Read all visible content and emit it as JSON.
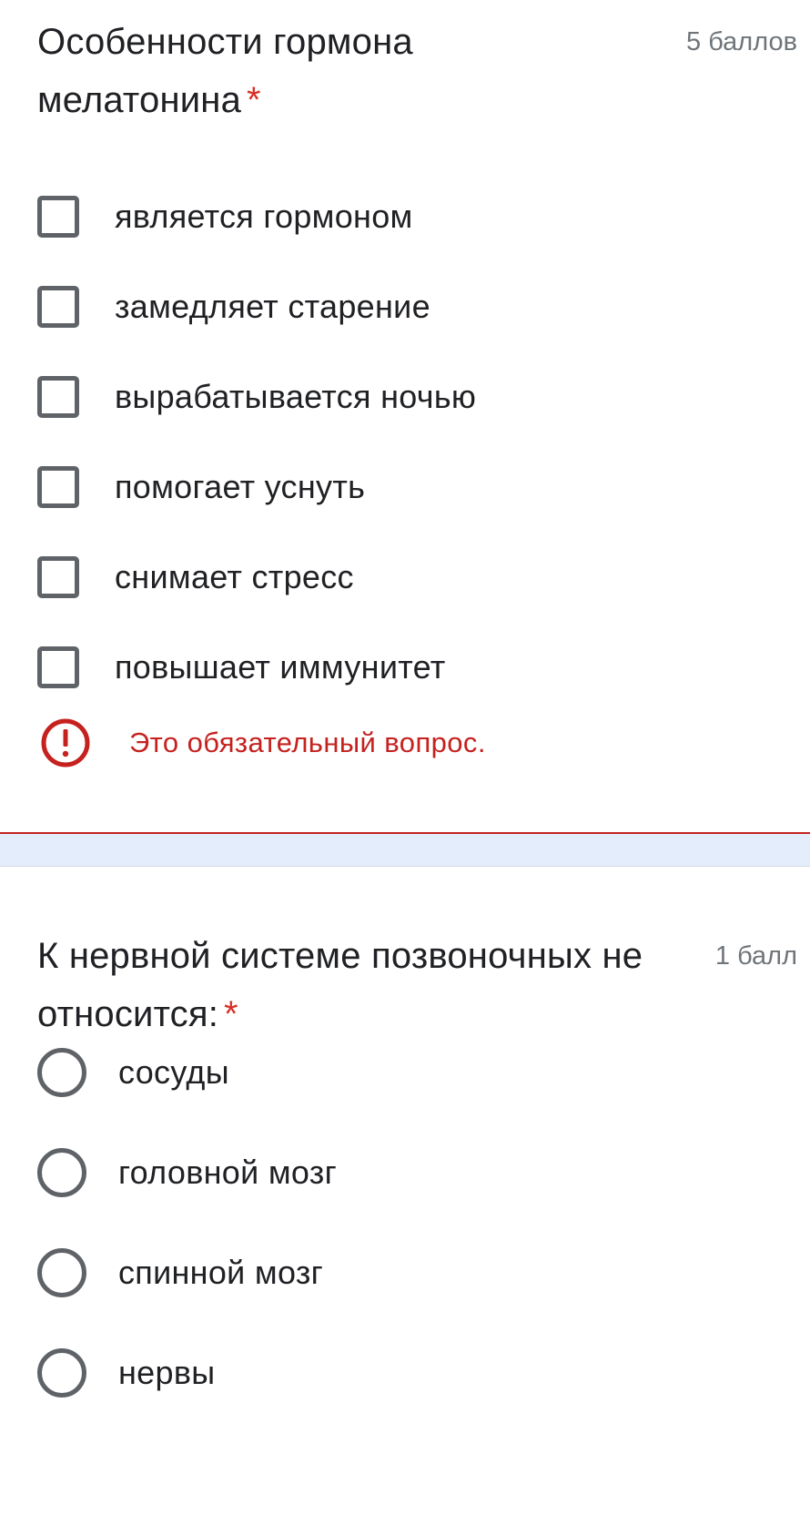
{
  "question1": {
    "title": "Особенности гормона мелатонина",
    "required_mark": "*",
    "points": "5 баллов",
    "options": [
      {
        "label": "является гормоном"
      },
      {
        "label": "замедляет старение"
      },
      {
        "label": "вырабатывается ночью"
      },
      {
        "label": "помогает уснуть"
      },
      {
        "label": "снимает стресс"
      },
      {
        "label": "повышает иммунитет"
      }
    ],
    "error_text": "Это обязательный вопрос.",
    "error_icon": "exclamation-circle-icon"
  },
  "question2": {
    "title": "К нервной системе позвоночных не относится:",
    "required_mark": "*",
    "points": "1 балл",
    "options": [
      {
        "label": "сосуды"
      },
      {
        "label": "головной мозг"
      },
      {
        "label": "спинной мозг"
      },
      {
        "label": "нервы"
      }
    ]
  },
  "colors": {
    "error": "#c5221f",
    "required": "#d93025",
    "control_border": "#5f6368",
    "band": "#e3edfc"
  }
}
